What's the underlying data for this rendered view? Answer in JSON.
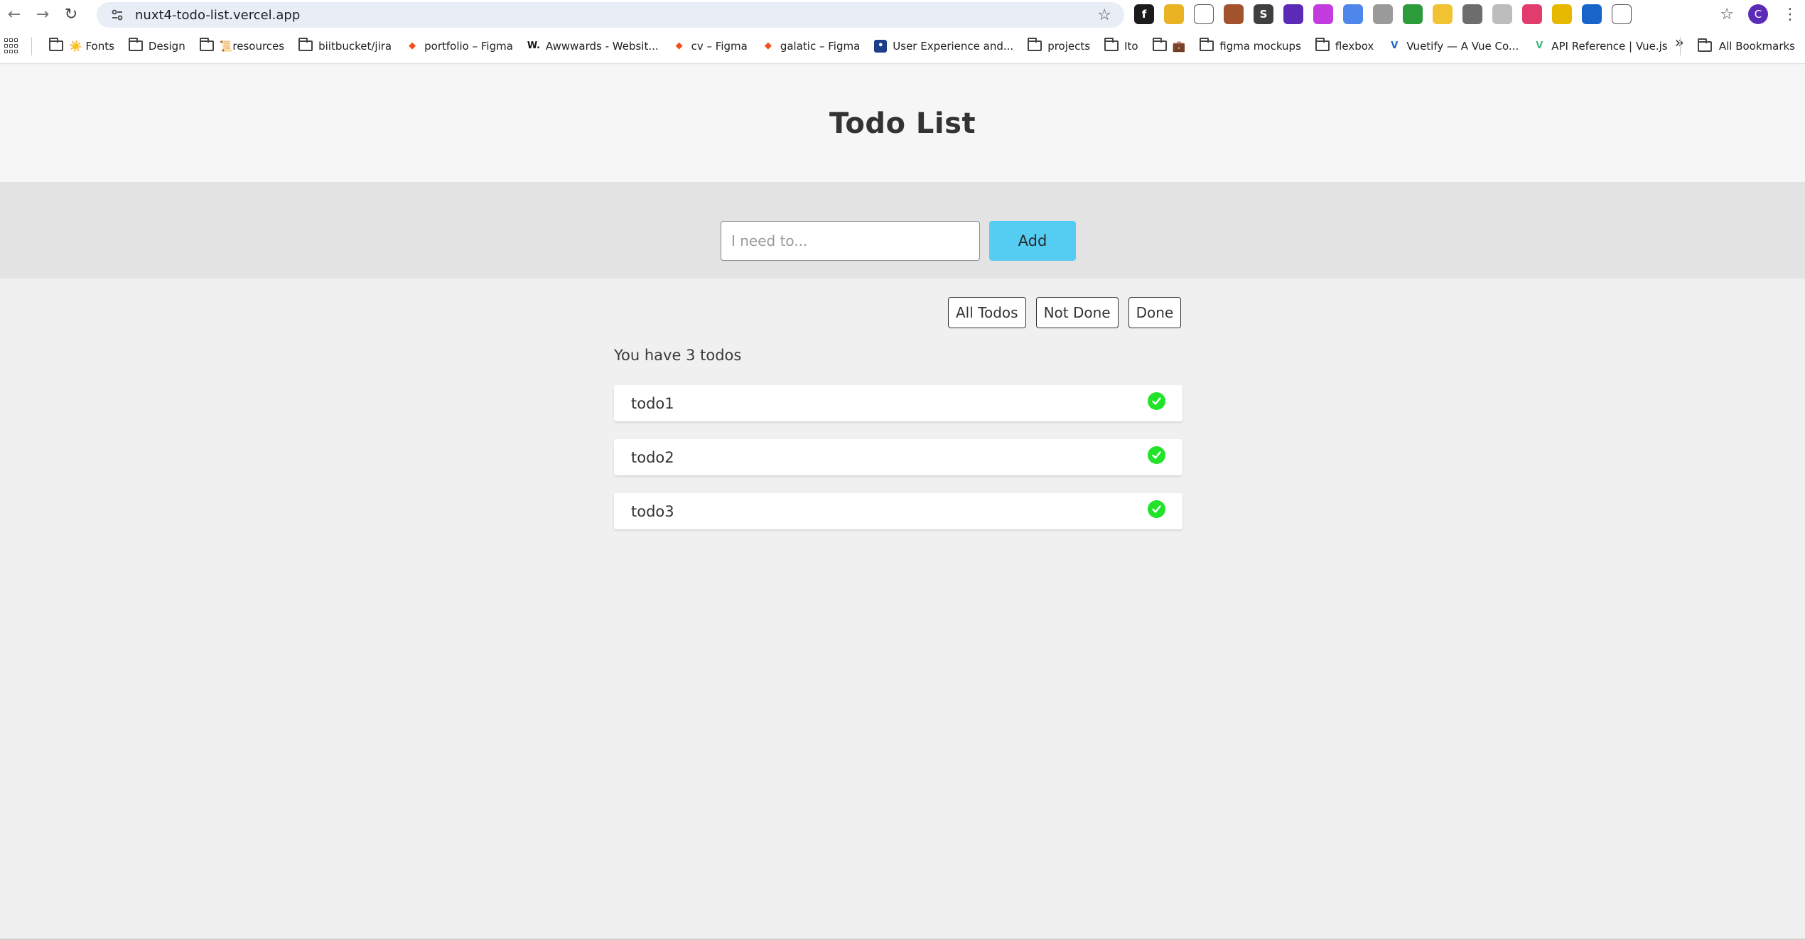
{
  "browser": {
    "url": "nuxt4-todo-list.vercel.app",
    "profile_initial": "C",
    "extensions": [
      {
        "icon": "fontface-ninja-icon",
        "glyph": "f",
        "bg": "#1b1b1b"
      },
      {
        "icon": "rss-icon",
        "glyph": "",
        "bg": "#e9b323"
      },
      {
        "icon": "color-picker-icon",
        "glyph": "",
        "bg": "#ffffff"
      },
      {
        "icon": "cookie-icon",
        "glyph": "",
        "bg": "#a2522c"
      },
      {
        "icon": "s-extension-icon",
        "glyph": "S",
        "bg": "#3f3f3f"
      },
      {
        "icon": "graduation-cap-icon",
        "glyph": "",
        "bg": "#5b2bb8"
      },
      {
        "icon": "chat-extension-icon",
        "glyph": "",
        "bg": "#c43be0"
      },
      {
        "icon": "translate-icon",
        "glyph": "",
        "bg": "#4f86ec"
      },
      {
        "icon": "camera-icon",
        "glyph": "",
        "bg": "#9a9a9a"
      },
      {
        "icon": "green-square-icon",
        "glyph": "",
        "bg": "#2c9b39"
      },
      {
        "icon": "yellow-circle-icon",
        "glyph": "",
        "bg": "#f1c232"
      },
      {
        "icon": "grey-circle-icon",
        "glyph": "",
        "bg": "#6d6d6d"
      },
      {
        "icon": "window-icon",
        "glyph": "",
        "bg": "#bdbdbd"
      },
      {
        "icon": "pink-extension-icon",
        "glyph": "",
        "bg": "#e23c6f"
      },
      {
        "icon": "bar-chart-icon",
        "glyph": "",
        "bg": "#e7b800"
      },
      {
        "icon": "blue-circle-icon",
        "glyph": "",
        "bg": "#1765c8"
      },
      {
        "icon": "puzzle-icon",
        "glyph": "",
        "bg": "#ffffff"
      }
    ]
  },
  "bookmarks": [
    {
      "label": "☀️ Fonts",
      "type": "folder"
    },
    {
      "label": "Design",
      "type": "folder"
    },
    {
      "label": "📜resources",
      "type": "folder"
    },
    {
      "label": "biitbucket/jira",
      "type": "folder"
    },
    {
      "label": "portfolio – Figma",
      "type": "figma"
    },
    {
      "label": "Awwwards - Websit...",
      "type": "awwwards"
    },
    {
      "label": "cv – Figma",
      "type": "figma"
    },
    {
      "label": "galatic – Figma",
      "type": "figma"
    },
    {
      "label": "User Experience and...",
      "type": "ux"
    },
    {
      "label": "projects",
      "type": "folder"
    },
    {
      "label": "Ito",
      "type": "folder"
    },
    {
      "label": "💼",
      "type": "folder"
    },
    {
      "label": "figma mockups",
      "type": "folder"
    },
    {
      "label": "flexbox",
      "type": "folder"
    },
    {
      "label": "Vuetify — A Vue Co...",
      "type": "vuetify"
    },
    {
      "label": "API Reference | Vue.js",
      "type": "vue"
    }
  ],
  "bookmarks_all_label": "All Bookmarks",
  "app": {
    "title": "Todo List",
    "input_placeholder": "I need to...",
    "input_value": "",
    "add_label": "Add",
    "filters": [
      "All Todos",
      "Not Done",
      "Done"
    ],
    "count_text": "You have 3 todos",
    "todos": [
      {
        "text": "todo1",
        "done": true
      },
      {
        "text": "todo2",
        "done": true
      },
      {
        "text": "todo3",
        "done": true
      }
    ],
    "done_color": "#22e32a",
    "add_button_color": "#55ccf2"
  }
}
